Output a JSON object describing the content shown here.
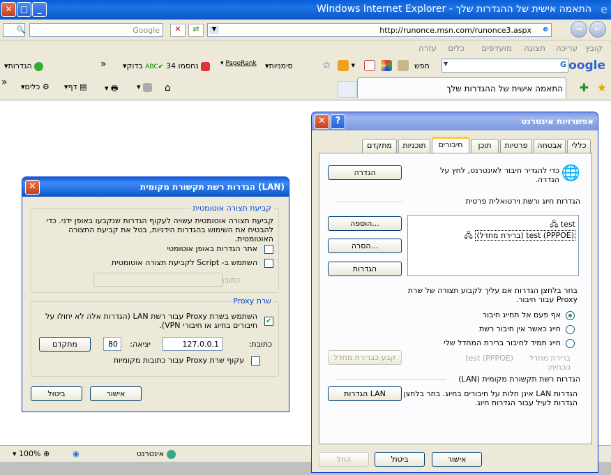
{
  "ie": {
    "title": "התאמה אישית של ההגדרות שלך - Windows Internet Explorer",
    "url": "http://runonce.msn.com/runonce3.aspx",
    "search_placeholder": "Google",
    "menu": [
      "קובץ",
      "עריכה",
      "תצוגה",
      "מועדפים",
      "כלים",
      "עזרה"
    ],
    "google_toolbar": {
      "logo": "Google",
      "search_btn": "חפש",
      "bookmarks": "סימניות",
      "pagerank": "PageRank",
      "blocked": "34 נחסמו",
      "check": "בדוק",
      "settings": "הגדרות"
    },
    "tab_title": "התאמה אישית של ההגדרות שלך",
    "cmd": {
      "page": "דף",
      "tools": "כלים"
    },
    "status": {
      "zone": "אינטרנט",
      "zoom": "100%"
    }
  },
  "internet_options": {
    "title": "אפשרויות אינטרנט",
    "help": "?",
    "tabs": [
      "כללי",
      "אבטחה",
      "פרטיות",
      "תוכן",
      "חיבורים",
      "תוכניות",
      "מתקדם"
    ],
    "setup_text": "כדי להגדיר חיבור לאינטרנט, לחץ על הגדרה.",
    "setup_btn": "הגדרה",
    "dialup_header": "הגדרות חיוג ורשת וירטואלית פרטית",
    "connections": [
      "test",
      "test (PPPOE) (ברירת מחדל)"
    ],
    "add_btn": "הוספה...",
    "remove_btn": "הסרה...",
    "settings_btn": "הגדרות",
    "proxy_text": "בחר בלחצן הגדרות אם עליך לקבוע תצורה של שרת Proxy עבור חיבור.",
    "radio": [
      "אף פעם אל תחייג חיבור",
      "חייג כאשר אין חיבור רשת",
      "חייג תמיד לחיבור ברירת המחדל שלי"
    ],
    "current_default_label": "ברירת מחדל נוכחית:",
    "current_default_value": "test (PPPOE)",
    "set_default_btn": "קבע כברירת מחדל",
    "lan_header": "הגדרות רשת תקשורת מקומית (LAN)",
    "lan_text": "הגדרות LAN אינן חלות על חיבורים בחיוג. בחר בלחצן הגדרות לעיל עבור הגדרות חיוג.",
    "lan_btn": "הגדרות LAN",
    "ok": "אישור",
    "cancel": "ביטול",
    "apply": "החל"
  },
  "lan": {
    "title": "הגדרות רשת תקשורת מקומית (LAN)",
    "auto_group": "קביעת תצורה אוטומטית",
    "auto_text": "קביעת תצורה אוטומטית עשויה לעקוף הגדרות שנקבעו באופן ידני. כדי להבטיח את השימוש בהגדרות הידניות, בטל את קביעת התצורה האוטומטית.",
    "auto_detect": "אתר הגדרות באופן אוטומטי",
    "use_script": "השתמש ב- Script לקביעת תצורה אוטומטית",
    "address_label": "כתובת",
    "proxy_group": "שרת Proxy",
    "use_proxy": "השתמש בשרת Proxy עבור רשת LAN (הגדרות אלה לא יחולו על חיבורים בחיוג או חיבורי VPN).",
    "addr_label": "כתובת:",
    "addr_value": "127.0.0.1",
    "port_label": "יציאה:",
    "port_value": "80",
    "advanced_btn": "מתקדם",
    "bypass": "עקוף שרת Proxy עבור כתובות מקומיות",
    "ok": "אישור",
    "cancel": "ביטול"
  }
}
